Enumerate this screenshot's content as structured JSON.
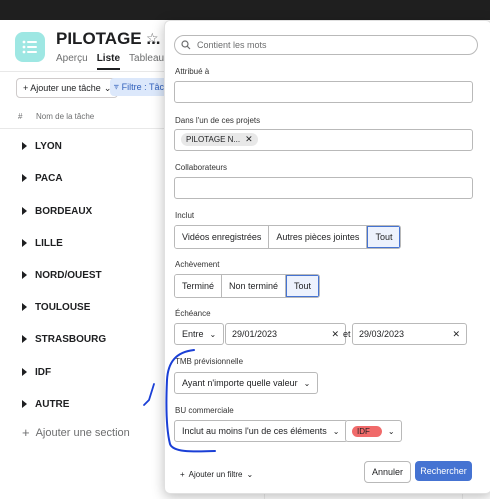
{
  "header": {
    "project_title": "PILOTAGE ...",
    "tabs": [
      "Aperçu",
      "Liste",
      "Tableau"
    ],
    "active_tab": "Liste"
  },
  "toolbar": {
    "add_task": "+ Ajouter une tâche",
    "add_task_chevron": "⌄",
    "filter_chip": "Filtre : Tâche"
  },
  "list": {
    "col_hash": "#",
    "col_task_name": "Nom de la tâche",
    "sections": [
      "LYON",
      "PACA",
      "BORDEAUX",
      "LILLE",
      "NORD/OUEST",
      "TOULOUSE",
      "STRASBOURG",
      "IDF",
      "AUTRE"
    ],
    "add_section": "Ajouter une section"
  },
  "filter_panel": {
    "search_placeholder": "Contient les mots",
    "assigned_label": "Attribué à",
    "projects_label": "Dans l'un de ces projets",
    "project_chip": "PILOTAGE N...",
    "collaborators_label": "Collaborateurs",
    "included_label": "Inclut",
    "included_options": [
      "Vidéos enregistrées",
      "Autres pièces jointes",
      "Tout"
    ],
    "included_selected": "Tout",
    "completion_label": "Achèvement",
    "completion_options": [
      "Terminé",
      "Non terminé",
      "Tout"
    ],
    "completion_selected": "Tout",
    "due_label": "Échéance",
    "due_mode": "Entre",
    "due_start": "29/01/2023",
    "due_and": "et",
    "due_end": "29/03/2023",
    "tmb_label": "TMB prévisionnelle",
    "tmb_value": "Ayant n'importe quelle valeur",
    "bu_label": "BU commerciale",
    "bu_operator": "Inclut au moins l'un de ces éléments",
    "bu_value": "IDF",
    "add_filter": "Ajouter un filtre",
    "cancel": "Annuler",
    "search": "Rechercher"
  },
  "colors": {
    "accent": "#4573d2",
    "project_icon": "#9ee7e3",
    "idf_pill": "#f06a6a",
    "annotation_ink": "#1a3fd6"
  }
}
